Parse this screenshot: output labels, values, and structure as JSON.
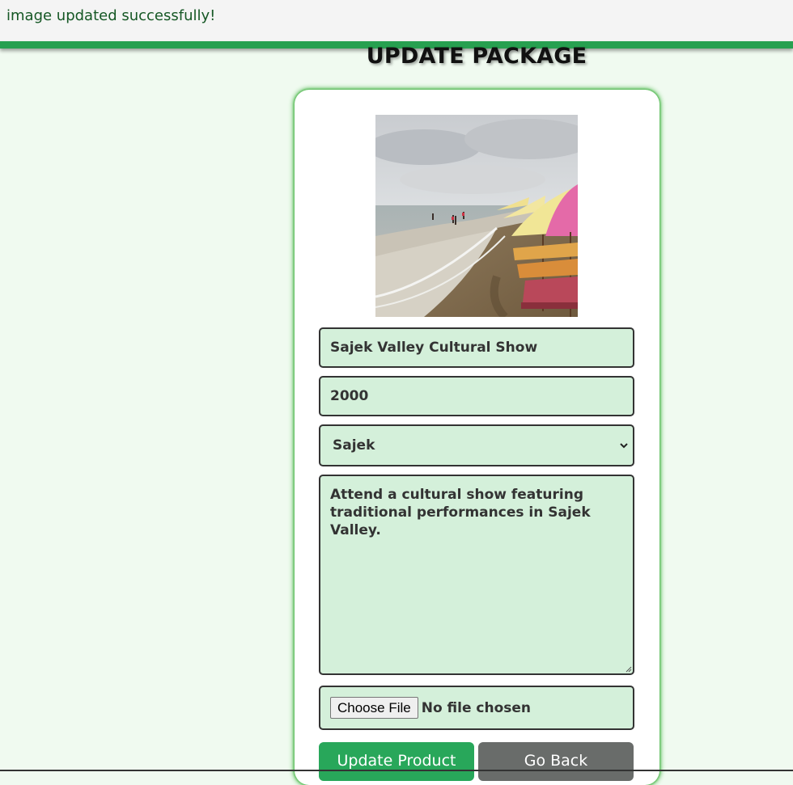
{
  "alert": {
    "message": "image updated successfully!"
  },
  "page": {
    "title": "UPDATE PACKAGE"
  },
  "form": {
    "name_value": "Sajek Valley Cultural Show",
    "price_value": "2000",
    "location_selected": "Sajek",
    "description_value": "Attend a cultural show featuring traditional performances in Sajek Valley.",
    "file": {
      "button_label": "Choose File",
      "status": "No file chosen"
    },
    "update_button": "Update Product",
    "back_button": "Go Back"
  },
  "colors": {
    "alert_text": "#155724",
    "alert_line": "#27a050",
    "page_bg": "#f0faf0",
    "field_bg": "#d4f0da",
    "update_button": "#28a75a",
    "back_button": "#696c6a"
  }
}
